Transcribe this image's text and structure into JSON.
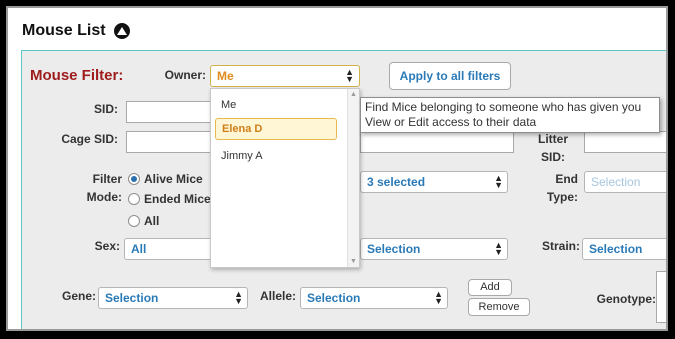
{
  "header": {
    "title": "Mouse List"
  },
  "filter": {
    "title": "Mouse Filter:",
    "owner_label": "Owner:",
    "owner_value": "Me",
    "apply_label": "Apply to all filters",
    "owner_options": [
      "Me",
      "Elena D",
      "Jimmy A"
    ],
    "owner_highlighted": "Elena D",
    "tooltip": "Find Mice belonging to someone who has given you View or Edit access to their data",
    "sid_label": "SID:",
    "cage_sid_label": "Cage SID:",
    "litter_sid_label": "Litter SID:",
    "filter_mode_label": "Filter Mode:",
    "modes": [
      "Alive Mice",
      "Ended Mice",
      "All"
    ],
    "mode_selected": "Alive Mice",
    "multi_selected": "3 selected",
    "end_type_label": "End Type:",
    "end_type_value": "Selection",
    "sex_label": "Sex:",
    "sex_value": "All",
    "mid_selection": "Selection",
    "strain_label": "Strain:",
    "strain_value": "Selection",
    "gene_label": "Gene:",
    "gene_value": "Selection",
    "allele_label": "Allele:",
    "allele_value": "Selection",
    "add_label": "Add",
    "remove_label": "Remove",
    "genotype_label": "Genotype:"
  }
}
